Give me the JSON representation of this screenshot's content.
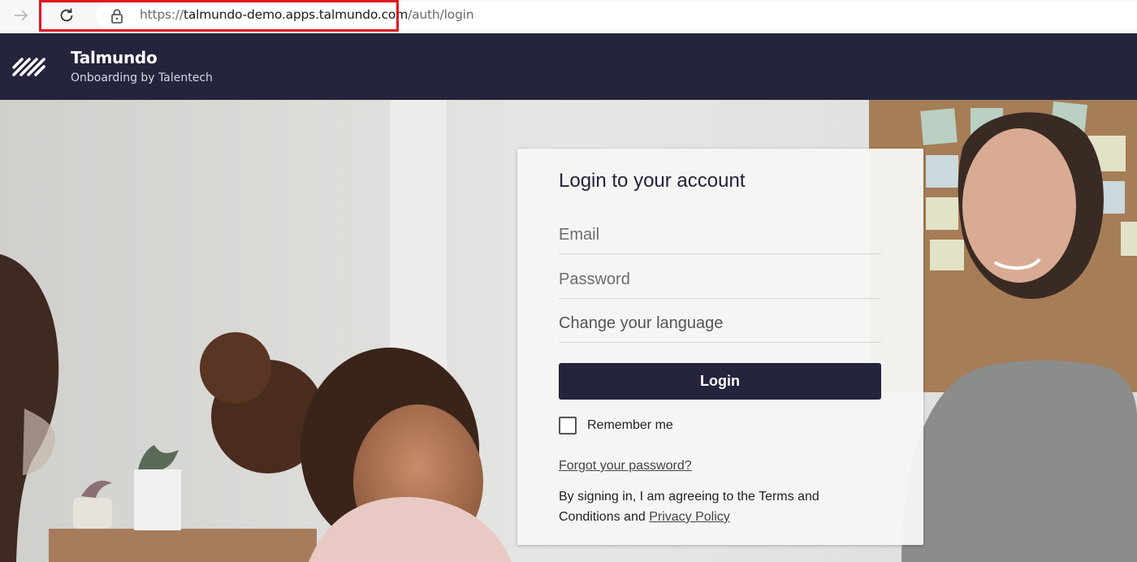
{
  "browser": {
    "url_scheme": "https://",
    "url_host": "talmundo-demo.apps.talmundo.com",
    "url_path": "/auth/login",
    "icons": [
      "forward-arrow-icon",
      "reload-icon",
      "lock-icon"
    ]
  },
  "header": {
    "brand_name": "Talmundo",
    "brand_tagline": "Onboarding by Talentech",
    "background_color": "#24243d"
  },
  "login": {
    "title": "Login to your account",
    "email_placeholder": "Email",
    "password_placeholder": "Password",
    "language_label": "Change your language",
    "login_button": "Login",
    "remember_me": "Remember me",
    "forgot_password": "Forgot your password?",
    "terms_text": "By signing in, I am agreeing to the Terms and Conditions and",
    "privacy_link": "Privacy Policy"
  },
  "colors": {
    "accent": "#24243d",
    "url_highlight": "#e0141e"
  }
}
